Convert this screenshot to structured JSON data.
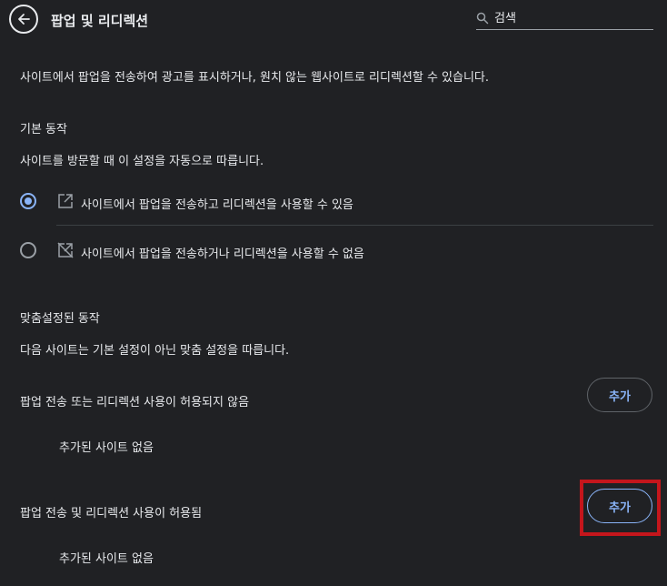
{
  "header": {
    "title": "팝업 및 리디렉션",
    "search_placeholder": "검색"
  },
  "description": "사이트에서 팝업을 전송하여 광고를 표시하거나, 원치 않는 웹사이트로 리디렉션할 수 있습니다.",
  "default_behavior": {
    "heading": "기본 동작",
    "subtitle": "사이트를 방문할 때 이 설정을 자동으로 따릅니다.",
    "options": [
      {
        "label": "사이트에서 팝업을 전송하고 리디렉션을 사용할 수 있음",
        "icon": "popup-allowed-icon",
        "selected": true
      },
      {
        "label": "사이트에서 팝업을 전송하거나 리디렉션을 사용할 수 없음",
        "icon": "popup-blocked-icon",
        "selected": false
      }
    ]
  },
  "custom_behavior": {
    "heading": "맞춤설정된 동작",
    "subtitle": "다음 사이트는 기본 설정이 아닌 맞춤 설정을 따릅니다.",
    "sections": [
      {
        "title": "팝업 전송 또는 리디렉션 사용이 허용되지 않음",
        "add_label": "추가",
        "empty_text": "추가된 사이트 없음"
      },
      {
        "title": "팝업 전송 및 리디렉션 사용이 허용됨",
        "add_label": "추가",
        "empty_text": "추가된 사이트 없음"
      }
    ]
  },
  "colors": {
    "background": "#202124",
    "accent": "#8ab4f8",
    "highlight": "#c4161c"
  }
}
